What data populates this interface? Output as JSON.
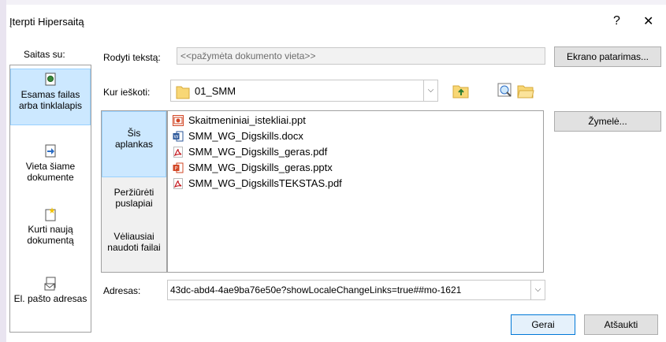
{
  "dialog": {
    "title": "Įterpti Hipersaitą",
    "help_glyph": "?",
    "close_glyph": "✕"
  },
  "link_to": {
    "label": "Saitas su:",
    "items": [
      {
        "label": "Esamas failas arba tinklalapis",
        "selected": true,
        "icon": "existing-file-icon"
      },
      {
        "label": "Vieta šiame dokumente",
        "selected": false,
        "icon": "place-in-document-icon"
      },
      {
        "label": "Kurti naują dokumentą",
        "selected": false,
        "icon": "new-document-icon"
      },
      {
        "label": "El. pašto adresas",
        "selected": false,
        "icon": "email-icon"
      }
    ]
  },
  "display_text": {
    "label": "Rodyti tekstą:",
    "value": "<<pažymėta dokumento vieta>>"
  },
  "screen_tip_button": "Ekrano patarimas...",
  "look_in": {
    "label": "Kur ieškoti:",
    "value": "01_SMM"
  },
  "bookmark_button": "Žymelė...",
  "look_panel": {
    "items": [
      {
        "label": "Šis aplankas",
        "selected": true
      },
      {
        "label": "Peržiūrėti puslapiai",
        "selected": false
      },
      {
        "label": "Vėliausiai naudoti failai",
        "selected": false
      }
    ]
  },
  "files": [
    {
      "name": "Skaitmeniniai_istekliai.ppt",
      "type": "ppt"
    },
    {
      "name": "SMM_WG_Digskills.docx",
      "type": "docx"
    },
    {
      "name": "SMM_WG_Digskills_geras.pdf",
      "type": "pdf"
    },
    {
      "name": "SMM_WG_Digskills_geras.pptx",
      "type": "pptx"
    },
    {
      "name": "SMM_WG_DigskillsTEKSTAS.pdf",
      "type": "pdf"
    }
  ],
  "address": {
    "label": "Adresas:",
    "value": "43dc-abd4-4ae9ba76e50e?showLocaleChangeLinks=true##mo-1621"
  },
  "ok_button": "Gerai",
  "cancel_button": "Atšaukti",
  "colors": {
    "selection": "#cce8ff",
    "accent": "#0078d7",
    "pdf_red": "#c4161c",
    "word_blue": "#2b579a",
    "ppt_orange": "#d24726",
    "folder_yellow": "#f8d775"
  }
}
